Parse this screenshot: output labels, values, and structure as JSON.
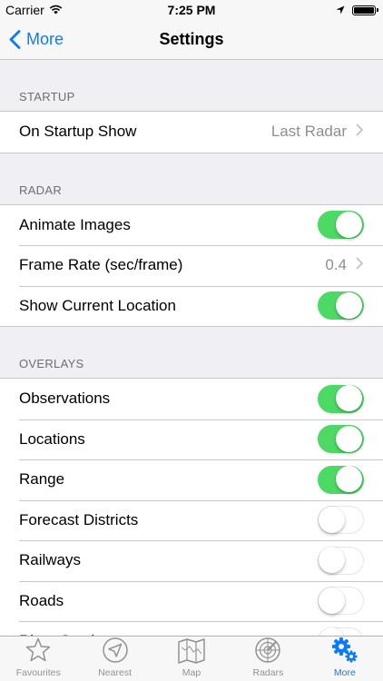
{
  "status_bar": {
    "carrier": "Carrier",
    "time": "7:25 PM"
  },
  "nav": {
    "back_label": "More",
    "title": "Settings"
  },
  "sections": [
    {
      "header": "STARTUP",
      "rows": [
        {
          "label": "On Startup Show",
          "type": "disclosure",
          "value": "Last Radar"
        }
      ]
    },
    {
      "header": "RADAR",
      "rows": [
        {
          "label": "Animate Images",
          "type": "toggle",
          "on": true
        },
        {
          "label": "Frame Rate (sec/frame)",
          "type": "disclosure",
          "value": "0.4"
        },
        {
          "label": "Show Current Location",
          "type": "toggle",
          "on": true
        }
      ]
    },
    {
      "header": "OVERLAYS",
      "rows": [
        {
          "label": "Observations",
          "type": "toggle",
          "on": true
        },
        {
          "label": "Locations",
          "type": "toggle",
          "on": true
        },
        {
          "label": "Range",
          "type": "toggle",
          "on": true
        },
        {
          "label": "Forecast Districts",
          "type": "toggle",
          "on": false
        },
        {
          "label": "Railways",
          "type": "toggle",
          "on": false
        },
        {
          "label": "Roads",
          "type": "toggle",
          "on": false
        },
        {
          "label": "River Catchments",
          "type": "toggle",
          "on": false
        }
      ]
    }
  ],
  "tab_bar": [
    {
      "label": "Favourites",
      "icon": "star-icon",
      "active": false
    },
    {
      "label": "Nearest",
      "icon": "compass-arrow-icon",
      "active": false
    },
    {
      "label": "Map",
      "icon": "map-icon",
      "active": false
    },
    {
      "label": "Radars",
      "icon": "radar-icon",
      "active": false
    },
    {
      "label": "More",
      "icon": "gears-icon",
      "active": true
    }
  ],
  "colors": {
    "accent": "#0a7aff",
    "toggle_on": "#4cd964",
    "background": "#efeff4",
    "inactive_tab": "#929292"
  }
}
